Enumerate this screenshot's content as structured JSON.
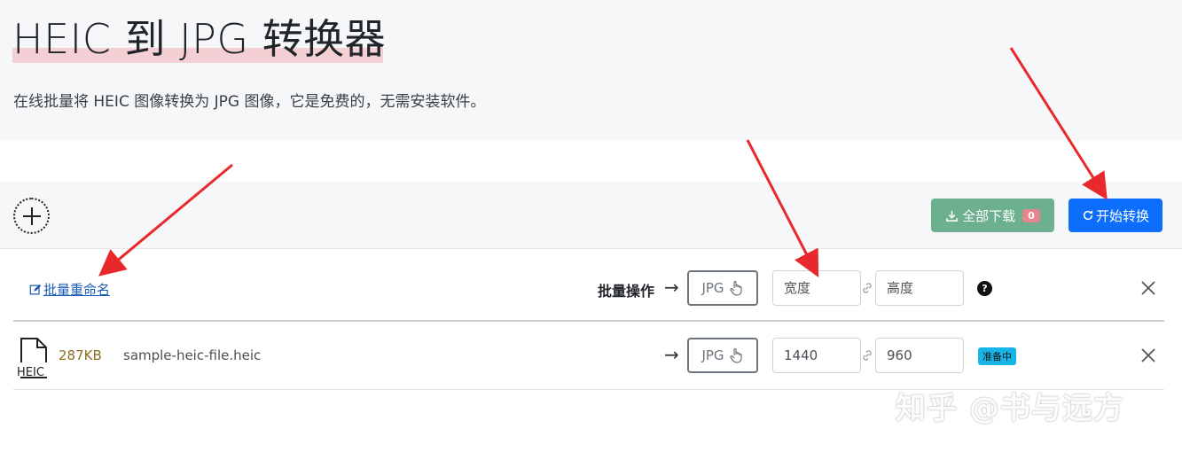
{
  "hero": {
    "title": "HEIC 到 JPG 转换器",
    "subtitle": "在线批量将 HEIC 图像转换为 JPG 图像，它是免费的，无需安装软件。"
  },
  "toolbar": {
    "add_icon": "plus-circle-icon",
    "download_all_label": "全部下载",
    "download_count": "0",
    "start_label": "开始转换",
    "colors": {
      "download": "#6cb08f",
      "start": "#0d6efd",
      "count_badge": "#e5858e"
    }
  },
  "batch": {
    "rename_label": "批量重命名",
    "ops_label": "批量操作",
    "format": "JPG",
    "width_placeholder": "宽度",
    "height_placeholder": "高度"
  },
  "files": [
    {
      "type_label": "HEIC",
      "size": "287KB",
      "name": "sample-heic-file.heic",
      "format": "JPG",
      "width": "1440",
      "height": "960",
      "status": "准备中",
      "status_color": "#18b6e8"
    }
  ],
  "watermark": "知乎 @书与远方"
}
